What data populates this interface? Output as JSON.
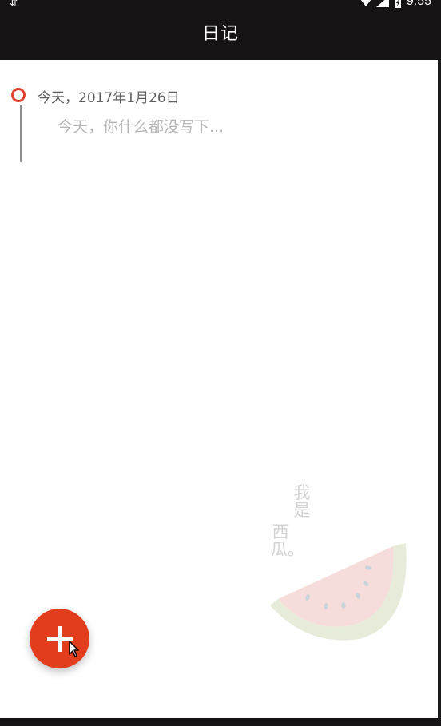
{
  "app": {
    "title": "日记"
  },
  "status_bar": {
    "time": "9:55"
  },
  "entry": {
    "date": "今天，2017年1月26日",
    "body": "今天，你什么都没写下..."
  },
  "watermark": {
    "line1": "我是",
    "line2": "西瓜。"
  },
  "fab": {
    "icon": "plus-icon"
  },
  "colors": {
    "accent": "#e23d1c",
    "timeline_circle": "#e0422f",
    "toolbar": "#151314"
  }
}
